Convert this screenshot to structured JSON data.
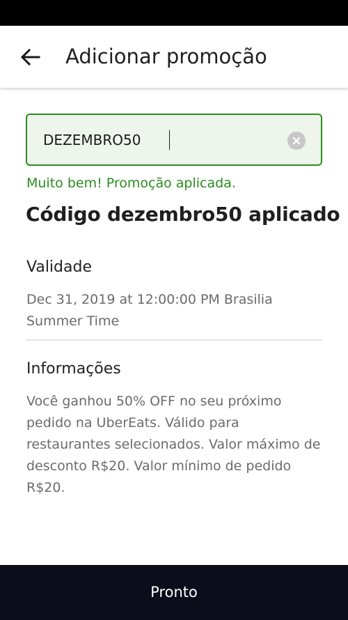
{
  "header": {
    "title": "Adicionar promoção",
    "back_icon": "arrow-left-icon"
  },
  "promo_input": {
    "value": "DEZEMBRO50",
    "clear_icon": "clear-circle-icon"
  },
  "colors": {
    "success": "#2b8c1e",
    "input_bg": "#eef5ec",
    "button_bg": "#0c0c1a"
  },
  "success_message": "Muito bem! Promoção aplicada.",
  "applied_title": "Código dezembro50 aplicado",
  "validity": {
    "label": "Validade",
    "value": "Dec 31, 2019 at 12:00:00 PM Brasilia Summer Time"
  },
  "info": {
    "label": "Informações",
    "text": "Você ganhou 50% OFF no seu próximo pedido na UberEats. Válido para restaurantes selecionados. Valor máximo de desconto R$20. Valor mínimo de pedido R$20."
  },
  "done_button": "Pronto"
}
